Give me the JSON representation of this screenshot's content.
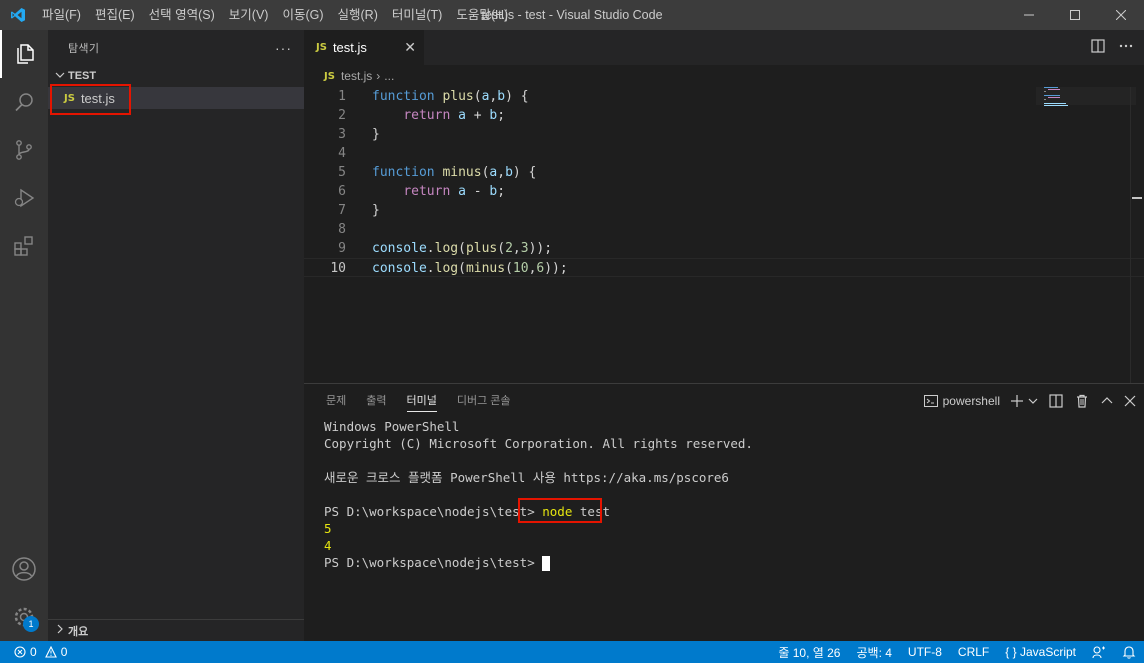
{
  "window": {
    "title": "test.js - test - Visual Studio Code"
  },
  "menu": [
    "파일(F)",
    "편집(E)",
    "선택 영역(S)",
    "보기(V)",
    "이동(G)",
    "실행(R)",
    "터미널(T)",
    "도움말(H)"
  ],
  "sidebar": {
    "title": "탐색기",
    "more": "···",
    "folder": "TEST",
    "file": {
      "badge": "JS",
      "name": "test.js"
    },
    "outline": "개요"
  },
  "activity": {
    "settings_badge": "1"
  },
  "editor": {
    "tab": {
      "badge": "JS",
      "name": "test.js",
      "close": "✕"
    },
    "breadcrumb": {
      "file": "test.js",
      "sep": "›",
      "rest": "..."
    },
    "line_numbers": [
      "1",
      "2",
      "3",
      "4",
      "5",
      "6",
      "7",
      "8",
      "9",
      "10"
    ]
  },
  "panel": {
    "tabs": [
      "문제",
      "출력",
      "터미널",
      "디버그 콘솔"
    ],
    "active_tab": "터미널",
    "shell": "powershell",
    "terminal_lines": [
      "Windows PowerShell",
      "Copyright (C) Microsoft Corporation. All rights reserved.",
      "",
      "새로운 크로스 플랫폼 PowerShell 사용 https://aka.ms/pscore6",
      ""
    ],
    "prompt": "PS D:\\workspace\\nodejs\\test>",
    "command_node": "node",
    "command_arg": "test",
    "output": [
      "5",
      "4"
    ],
    "prompt2": "PS D:\\workspace\\nodejs\\test>"
  },
  "status": {
    "errors": "0",
    "warnings": "0",
    "position": "줄 10, 열 26",
    "spaces": "공백: 4",
    "encoding": "UTF-8",
    "eol": "CRLF",
    "language": "JavaScript",
    "language_braces": "{ }"
  },
  "colors": {
    "accent": "#007acc",
    "highlight": "#e51400",
    "js": "#cbcb41"
  }
}
